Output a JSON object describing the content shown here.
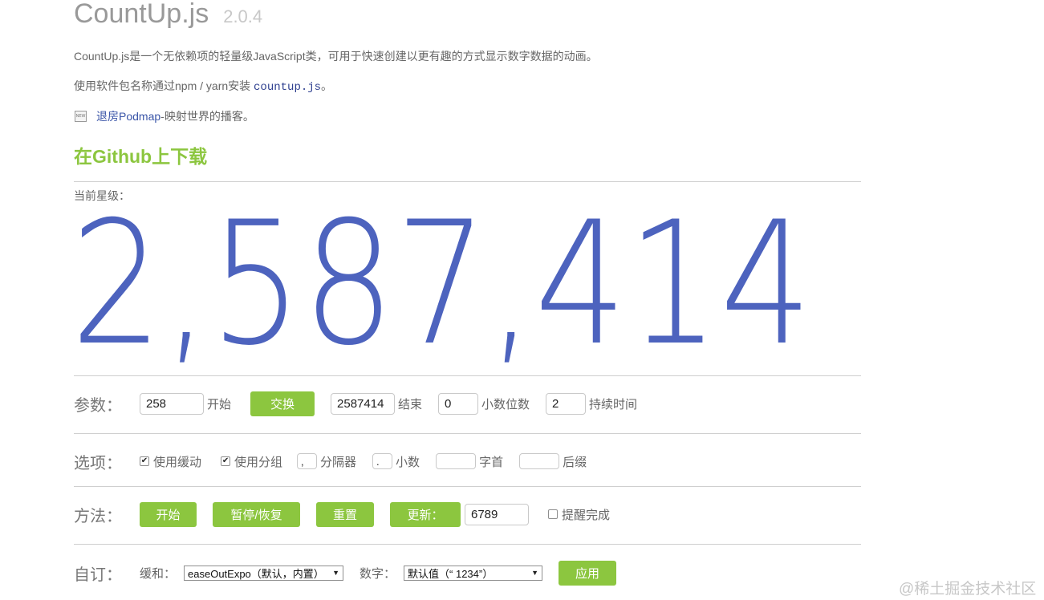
{
  "header": {
    "title": "CountUp.js",
    "version": "2.0.4"
  },
  "intro": {
    "description": "CountUp.js是一个无依赖项的轻量级JavaScript类，可用于快速创建以更有趣的方式显示数字数据的动画。",
    "install_prefix": "使用软件包名称通过npm / yarn安装",
    "install_code": "countup.js",
    "install_suffix": "。",
    "news_icon_text": "NEW",
    "news_link": "退房Podmap",
    "news_suffix": "-映射世界的播客。"
  },
  "download_title": "在Github上下载",
  "stars": {
    "label": "当前星级：",
    "value": "2,587,414"
  },
  "params": {
    "label": "参数：",
    "start_value": "258",
    "start_label": "开始",
    "swap_button": "交换",
    "end_value": "2587414",
    "end_label": "结束",
    "decimals_value": "0",
    "decimals_label": "小数位数",
    "duration_value": "2",
    "duration_label": "持续时间"
  },
  "options": {
    "label": "选项：",
    "use_easing": {
      "label": "使用缓动",
      "checked": true
    },
    "use_grouping": {
      "label": "使用分组",
      "checked": true
    },
    "separator_value": ",",
    "separator_label": "分隔器",
    "decimal_value": ".",
    "decimal_label": "小数",
    "prefix_value": "",
    "prefix_label": "字首",
    "suffix_value": "",
    "suffix_label": "后缀"
  },
  "methods": {
    "label": "方法：",
    "start_button": "开始",
    "pause_button": "暂停/恢复",
    "reset_button": "重置",
    "update_button": "更新：",
    "update_value": "6789",
    "alert_label": "提醒完成",
    "alert_checked": false
  },
  "custom": {
    "label": "自订：",
    "easing_label": "缓和：",
    "easing_selected": "easeOutExpo（默认，内置）",
    "numerals_label": "数字：",
    "numerals_selected": "默认值（“ 1234”）",
    "apply_button": "应用"
  },
  "watermark": "@稀土掘金技术社区",
  "colors": {
    "accent_green": "#8cc63f",
    "number_blue": "#4d63be",
    "link_blue": "#3a55a8"
  }
}
